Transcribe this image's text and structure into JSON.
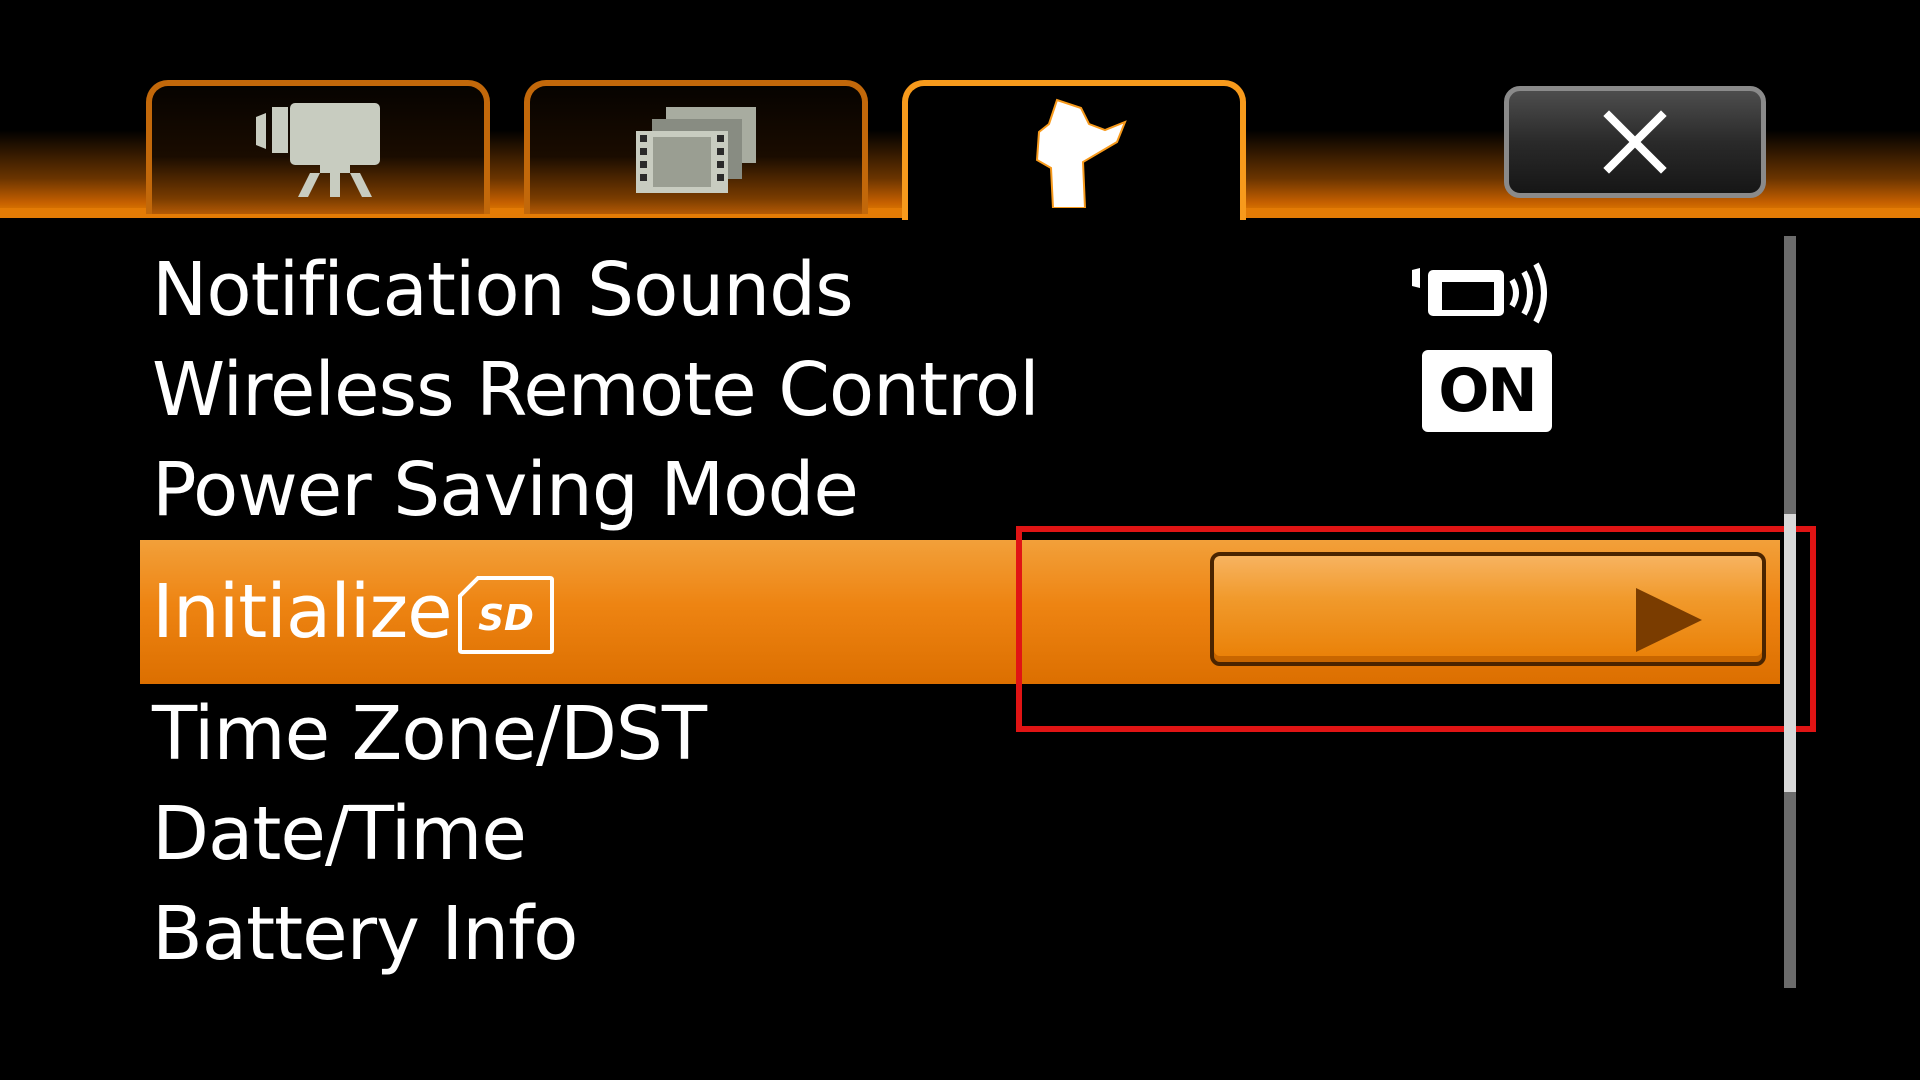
{
  "tabs": [
    {
      "name": "movie-camera-icon",
      "active": false
    },
    {
      "name": "playback-icon",
      "active": false
    },
    {
      "name": "wrench-setup-icon",
      "active": true
    }
  ],
  "close_icon": "close-icon",
  "menu": {
    "items": [
      {
        "label": "Notification Sounds",
        "value_icon": "notification-sound-icon"
      },
      {
        "label": "Wireless Remote Control",
        "value_text": "ON"
      },
      {
        "label": "Power Saving Mode"
      },
      {
        "label": "Initialize",
        "label_icon": "sd-card-icon",
        "selected": true,
        "action_icon": "right-arrow-icon"
      },
      {
        "label": "Time Zone/DST"
      },
      {
        "label": "Date/Time"
      },
      {
        "label": "Battery Info"
      }
    ]
  },
  "colors": {
    "accent": "#EE8412",
    "highlight_outline": "#E01414",
    "background": "#000000"
  },
  "scrollbar": {
    "position_fraction": 0.37
  }
}
